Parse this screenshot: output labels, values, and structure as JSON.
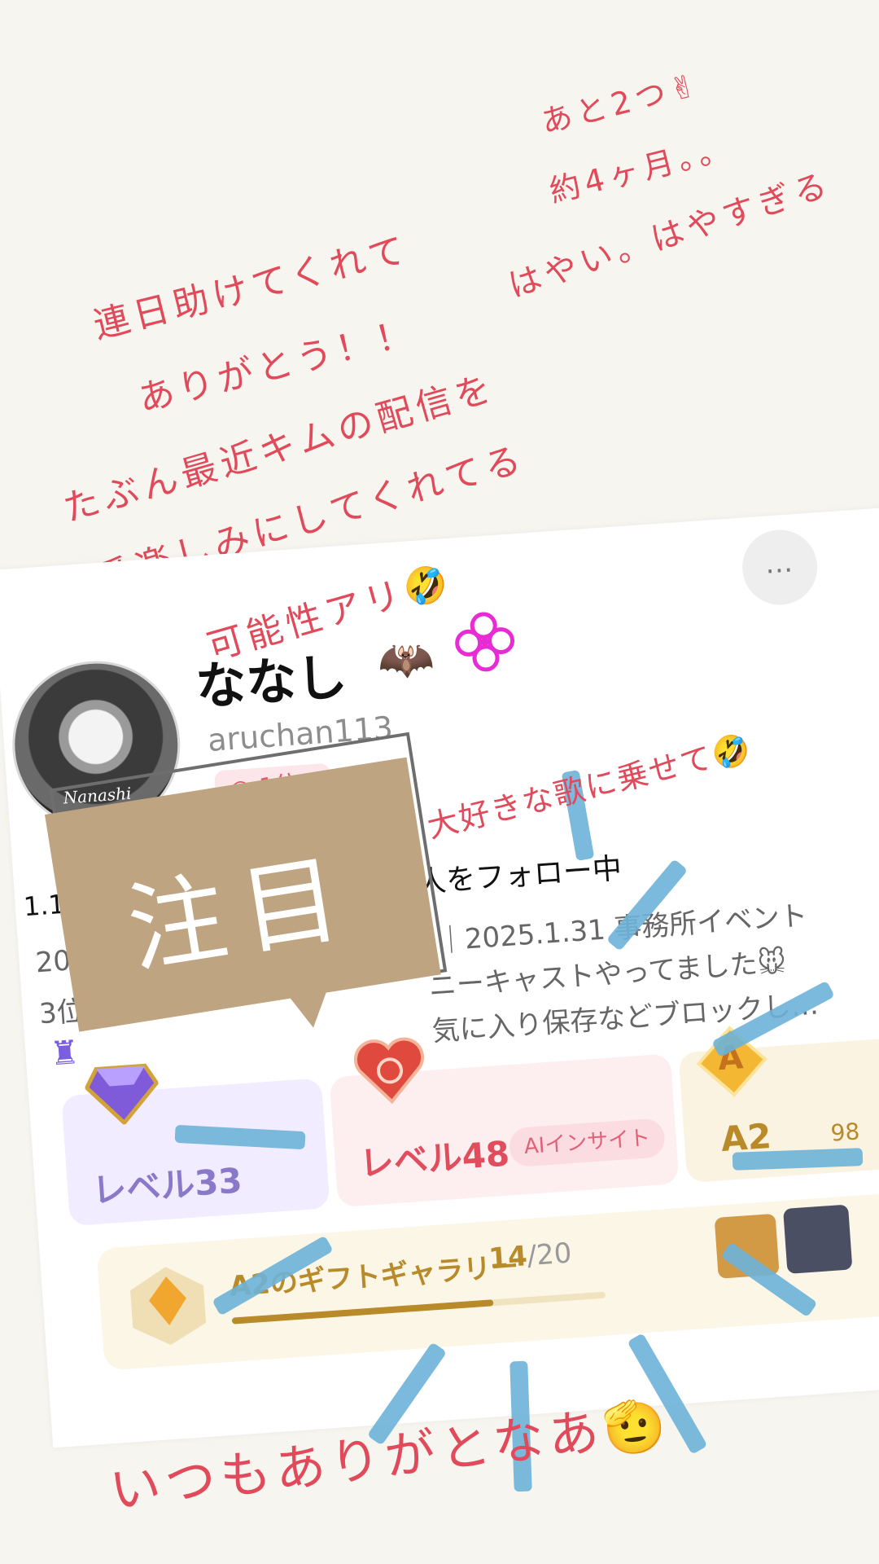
{
  "handwritten": {
    "line1": "あと2つ✌",
    "line2": "約4ヶ月。。",
    "line3": "はやい。はやすぎる",
    "line4": "連日助けてくれて",
    "line5": "ありがとう！！",
    "line6": "たぶん最近キムの配信を",
    "line7": "一番楽しみにしてくれてる",
    "line8": "可能性アリ🤣",
    "song": "大好きな歌に乗せて🤣",
    "closing": "いつもありがとなあ🫡"
  },
  "profile": {
    "name": "ななし",
    "name_emoji": "🦇",
    "avatar_signature": "Nanashi",
    "handle": "aruchan113",
    "rank": "1位",
    "more": "…",
    "followers_prefix": "1.1万人の",
    "following": "3 人をフォロー中",
    "bio_line1_a": "202",
    "bio_line1_b": "位｜2025.1.31 事務所イベント",
    "bio_line2_a": "3位",
    "bio_line2_b": "ニーキャストやってました🐭",
    "bio_line3": "気に入り保存などブロックし…",
    "castle_icon": "castle-icon"
  },
  "levels": {
    "purple": "レベル33",
    "pink": "レベル48",
    "ai_insight": "AIインサイト",
    "gold_partial": "A2",
    "gold_badge_text": "A",
    "gold_count_partial": "98"
  },
  "gift": {
    "title": "A2のギフトギャラリー",
    "count_current": "14",
    "count_total": "/20",
    "progress": 0.7
  },
  "sticker": {
    "text": "注目"
  },
  "colors": {
    "handwriting": "#e04a5a",
    "sticker": "#bfa482",
    "streaks": "#6db3d8"
  }
}
